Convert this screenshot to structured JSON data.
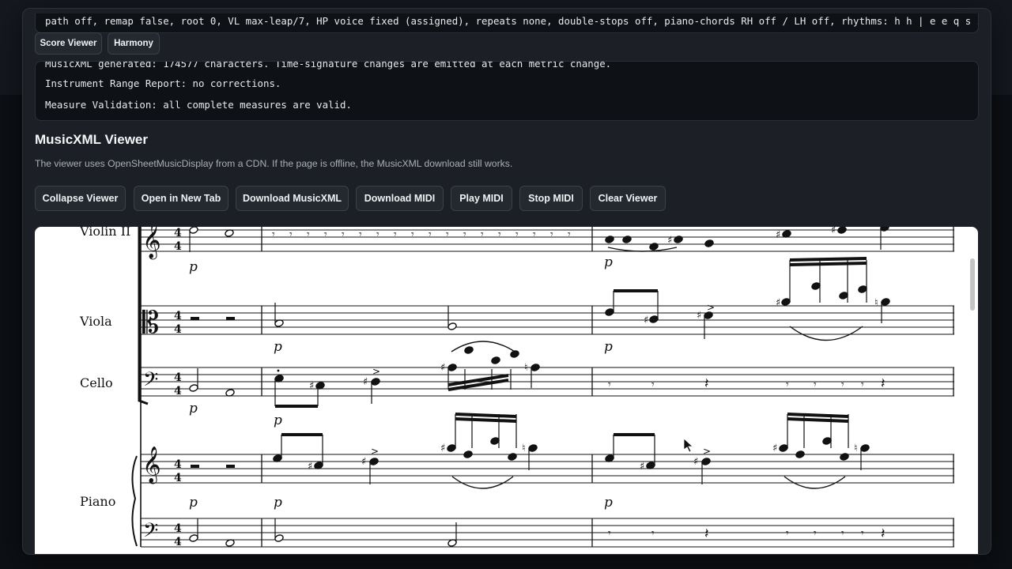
{
  "log": {
    "top_line": "path off, remap false, root 0, VL max-leap/7, HP voice fixed (assigned), repeats none, double-stops off, piano-chords RH off / LH off, rhythms: h h | e e q s s s s q",
    "report_partial": "MusicXML generated: 174577 characters. Time-signature changes are emitted at each metric change.",
    "report_range": "Instrument Range Report: no corrections.",
    "report_validation": "Measure Validation: all complete measures are valid."
  },
  "tabs": {
    "score_viewer": "Score Viewer",
    "harmony": "Harmony"
  },
  "viewer": {
    "title": "MusicXML Viewer",
    "description": "The viewer uses OpenSheetMusicDisplay from a CDN. If the page is offline, the MusicXML download still works.",
    "buttons": {
      "collapse": "Collapse Viewer",
      "open_tab": "Open in New Tab",
      "download_xml": "Download MusicXML",
      "download_midi": "Download MIDI",
      "play_midi": "Play MIDI",
      "stop_midi": "Stop MIDI",
      "clear": "Clear Viewer"
    }
  },
  "score": {
    "instruments": [
      "Violin II",
      "Viola",
      "Cello",
      "Piano"
    ],
    "time_signature": "4/4",
    "dynamic": "p"
  }
}
